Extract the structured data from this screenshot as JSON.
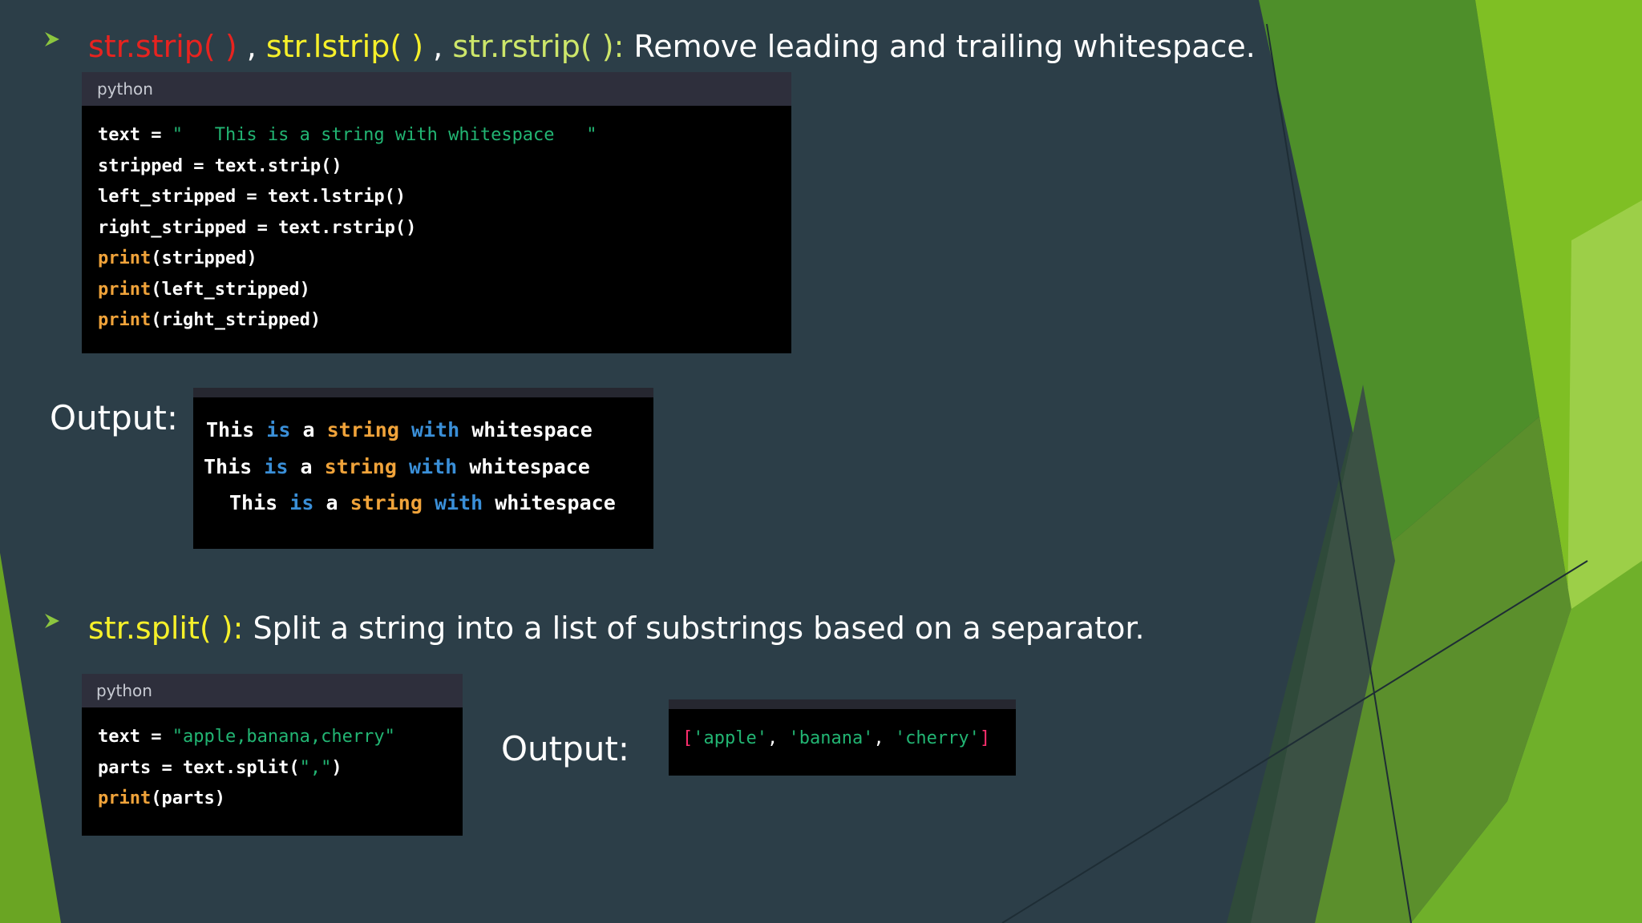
{
  "colors": {
    "background": "#2c3e48",
    "accent_green": "#7fbf24",
    "title_red": "#e8231f",
    "title_yellow": "#f6f02a",
    "title_lime": "#cde66a"
  },
  "bullet1": {
    "icon": "arrow-bullet-icon",
    "strip": "str.strip( )",
    "sep1": " , ",
    "lstrip": "str.lstrip( )",
    "sep2": " , ",
    "rstrip": "str.rstrip( ):",
    "description": " Remove leading and trailing whitespace."
  },
  "code1": {
    "lang": "python",
    "line1": {
      "a": "text = ",
      "b": "\"   This is a string with whitespace   \""
    },
    "line2": "stripped = text.strip()",
    "line3": "left_stripped = text.lstrip()",
    "line4": "right_stripped = text.rstrip()",
    "line5": {
      "fn": "print",
      "rest": "(stripped)"
    },
    "line6": {
      "fn": "print",
      "rest": "(left_stripped)"
    },
    "line7": {
      "fn": "print",
      "rest": "(right_stripped)"
    }
  },
  "output1": {
    "label": "Output:",
    "words": {
      "w1": "This",
      "w2": "is",
      "w3": "a",
      "w4": "string",
      "w5": "with",
      "w6": "whitespace"
    }
  },
  "bullet2": {
    "icon": "arrow-bullet-icon",
    "split": "str.split( ):",
    "description": " Split a string into a list of substrings based on a separator."
  },
  "code2": {
    "lang": "python",
    "line1": {
      "a": "text = ",
      "b": "\"apple,banana,cherry\""
    },
    "line2": {
      "a": "parts = text.split(",
      "b": "\",\"",
      "c": ")"
    },
    "line3": {
      "fn": "print",
      "rest": "(parts)"
    }
  },
  "output2": {
    "label": "Output:",
    "open": "[",
    "item1": "'apple'",
    "comma1": ", ",
    "item2": "'banana'",
    "comma2": ", ",
    "item3": "'cherry'",
    "close": "]"
  }
}
